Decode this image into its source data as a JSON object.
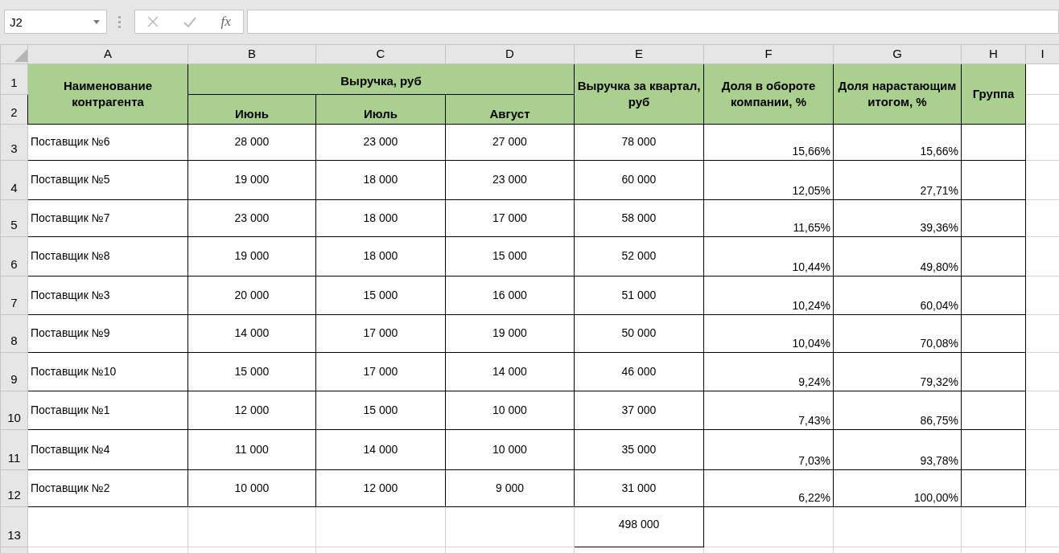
{
  "formula_bar": {
    "name_box": "J2",
    "function_button": "fx"
  },
  "columns": [
    "A",
    "B",
    "C",
    "D",
    "E",
    "F",
    "G",
    "H",
    "I"
  ],
  "header": {
    "name": "Наименование контрагента",
    "revenue": "Выручка, руб",
    "months": [
      "Июнь",
      "Июль",
      "Август"
    ],
    "quarter": "Выручка за квартал, руб",
    "share": "Доля в обороте компании, %",
    "cumulative": "Доля нарастающим итогом, %",
    "group": "Группа",
    "row_numbers": [
      "1",
      "2"
    ]
  },
  "rows": [
    {
      "row_number": "3",
      "name": "Поставщик №6",
      "june": "28 000",
      "july": "23 000",
      "august": "27 000",
      "quarter": "78 000",
      "share": "15,66%",
      "cumulative": "15,66%"
    },
    {
      "row_number": "4",
      "name": "Поставщик №5",
      "june": "19 000",
      "july": "18 000",
      "august": "23 000",
      "quarter": "60 000",
      "share": "12,05%",
      "cumulative": "27,71%"
    },
    {
      "row_number": "5",
      "name": "Поставщик №7",
      "june": "23 000",
      "july": "18 000",
      "august": "17 000",
      "quarter": "58 000",
      "share": "11,65%",
      "cumulative": "39,36%"
    },
    {
      "row_number": "6",
      "name": "Поставщик №8",
      "june": "19 000",
      "july": "18 000",
      "august": "15 000",
      "quarter": "52 000",
      "share": "10,44%",
      "cumulative": "49,80%"
    },
    {
      "row_number": "7",
      "name": "Поставщик №3",
      "june": "20 000",
      "july": "15 000",
      "august": "16 000",
      "quarter": "51 000",
      "share": "10,24%",
      "cumulative": "60,04%"
    },
    {
      "row_number": "8",
      "name": "Поставщик №9",
      "june": "14 000",
      "july": "17 000",
      "august": "19 000",
      "quarter": "50 000",
      "share": "10,04%",
      "cumulative": "70,08%"
    },
    {
      "row_number": "9",
      "name": "Поставщик №10",
      "june": "15 000",
      "july": "17 000",
      "august": "14 000",
      "quarter": "46 000",
      "share": "9,24%",
      "cumulative": "79,32%"
    },
    {
      "row_number": "10",
      "name": "Поставщик №1",
      "june": "12 000",
      "july": "15 000",
      "august": "10 000",
      "quarter": "37 000",
      "share": "7,43%",
      "cumulative": "86,75%"
    },
    {
      "row_number": "11",
      "name": "Поставщик №4",
      "june": "11 000",
      "july": "14 000",
      "august": "10 000",
      "quarter": "35 000",
      "share": "7,03%",
      "cumulative": "93,78%"
    },
    {
      "row_number": "12",
      "name": "Поставщик №2",
      "june": "10 000",
      "july": "12 000",
      "august": "9 000",
      "quarter": "31 000",
      "share": "6,22%",
      "cumulative": "100,00%"
    }
  ],
  "total": {
    "row_number": "13",
    "quarter": "498 000"
  }
}
